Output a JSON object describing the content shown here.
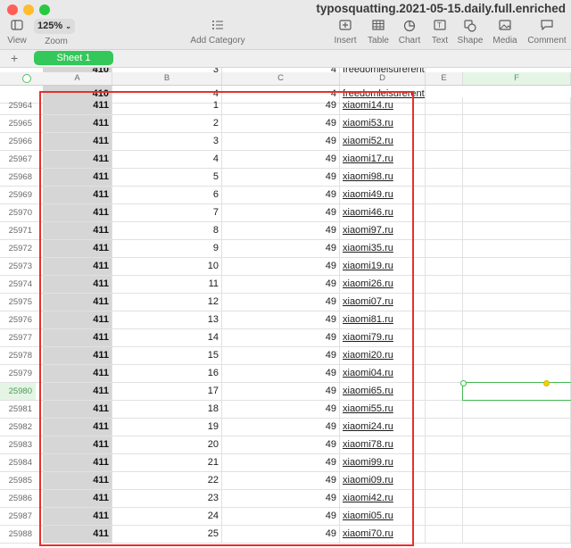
{
  "window": {
    "title": "typosquatting.2021-05-15.daily.full.enriched"
  },
  "toolbar": {
    "view": "View",
    "zoom_value": "125%",
    "zoom": "Zoom",
    "add_category": "Add Category",
    "insert": "Insert",
    "table": "Table",
    "chart": "Chart",
    "text": "Text",
    "shape": "Shape",
    "media": "Media",
    "comment": "Comment"
  },
  "sheets": {
    "add": "+",
    "active": "Sheet 1"
  },
  "columns": [
    "A",
    "B",
    "C",
    "D",
    "E",
    "F"
  ],
  "partial_rows": [
    {
      "num": "",
      "a": "410",
      "b": "3",
      "c": "4",
      "d": "freedomleisurerentals.co.uk"
    },
    {
      "num": "",
      "a": "410",
      "b": "4",
      "c": "4",
      "d": "freedomleisurerental.co.uk"
    }
  ],
  "rows": [
    {
      "num": "25964",
      "a": "411",
      "b": "1",
      "c": "49",
      "d": "xiaomi14.ru"
    },
    {
      "num": "25965",
      "a": "411",
      "b": "2",
      "c": "49",
      "d": "xiaomi53.ru"
    },
    {
      "num": "25966",
      "a": "411",
      "b": "3",
      "c": "49",
      "d": "xiaomi52.ru"
    },
    {
      "num": "25967",
      "a": "411",
      "b": "4",
      "c": "49",
      "d": "xiaomi17.ru"
    },
    {
      "num": "25968",
      "a": "411",
      "b": "5",
      "c": "49",
      "d": "xiaomi98.ru"
    },
    {
      "num": "25969",
      "a": "411",
      "b": "6",
      "c": "49",
      "d": "xiaomi49.ru"
    },
    {
      "num": "25970",
      "a": "411",
      "b": "7",
      "c": "49",
      "d": "xiaomi46.ru"
    },
    {
      "num": "25971",
      "a": "411",
      "b": "8",
      "c": "49",
      "d": "xiaomi97.ru"
    },
    {
      "num": "25972",
      "a": "411",
      "b": "9",
      "c": "49",
      "d": "xiaomi35.ru"
    },
    {
      "num": "25973",
      "a": "411",
      "b": "10",
      "c": "49",
      "d": "xiaomi19.ru"
    },
    {
      "num": "25974",
      "a": "411",
      "b": "11",
      "c": "49",
      "d": "xiaomi26.ru"
    },
    {
      "num": "25975",
      "a": "411",
      "b": "12",
      "c": "49",
      "d": "xiaomi07.ru"
    },
    {
      "num": "25976",
      "a": "411",
      "b": "13",
      "c": "49",
      "d": "xiaomi81.ru"
    },
    {
      "num": "25977",
      "a": "411",
      "b": "14",
      "c": "49",
      "d": "xiaomi79.ru"
    },
    {
      "num": "25978",
      "a": "411",
      "b": "15",
      "c": "49",
      "d": "xiaomi20.ru"
    },
    {
      "num": "25979",
      "a": "411",
      "b": "16",
      "c": "49",
      "d": "xiaomi04.ru"
    },
    {
      "num": "25980",
      "a": "411",
      "b": "17",
      "c": "49",
      "d": "xiaomi65.ru",
      "selected": true
    },
    {
      "num": "25981",
      "a": "411",
      "b": "18",
      "c": "49",
      "d": "xiaomi55.ru"
    },
    {
      "num": "25982",
      "a": "411",
      "b": "19",
      "c": "49",
      "d": "xiaomi24.ru"
    },
    {
      "num": "25983",
      "a": "411",
      "b": "20",
      "c": "49",
      "d": "xiaomi78.ru"
    },
    {
      "num": "25984",
      "a": "411",
      "b": "21",
      "c": "49",
      "d": "xiaomi99.ru"
    },
    {
      "num": "25985",
      "a": "411",
      "b": "22",
      "c": "49",
      "d": "xiaomi09.ru"
    },
    {
      "num": "25986",
      "a": "411",
      "b": "23",
      "c": "49",
      "d": "xiaomi42.ru"
    },
    {
      "num": "25987",
      "a": "411",
      "b": "24",
      "c": "49",
      "d": "xiaomi05.ru"
    },
    {
      "num": "25988",
      "a": "411",
      "b": "25",
      "c": "49",
      "d": "xiaomi70.ru"
    }
  ],
  "colors": {
    "accent_green": "#34c759",
    "annotation_red": "#e8312a",
    "selection_green": "#46b855"
  }
}
